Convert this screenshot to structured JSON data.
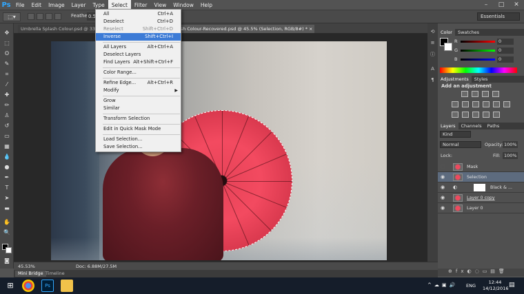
{
  "app": {
    "logo": "Ps"
  },
  "menubar": {
    "items": [
      "File",
      "Edit",
      "Image",
      "Layer",
      "Type",
      "Select",
      "Filter",
      "View",
      "Window",
      "Help"
    ],
    "active": "Select"
  },
  "window_controls": {
    "minimize": "–",
    "maximize": "□",
    "close": "✕"
  },
  "options": {
    "feather_label": "Feather:",
    "feather_value": "0.5",
    "workspace": "Essentials"
  },
  "tabs": {
    "doc1": "Umbrella Splash Colour.psd @ 33.3%",
    "doc2": "lsh Colour-Recovered.psd @ 45.5% (Selection, RGB/8#) * ×"
  },
  "status": {
    "zoom": "45.53%",
    "docsize": "Doc: 6.88M/27.5M"
  },
  "bottom_tabs": {
    "mini_bridge": "Mini Bridge",
    "timeline": "Timeline"
  },
  "select_menu": [
    {
      "label": "All",
      "shortcut": "Ctrl+A"
    },
    {
      "label": "Deselect",
      "shortcut": "Ctrl+D"
    },
    {
      "label": "Reselect",
      "shortcut": "Shift+Ctrl+D",
      "disabled": true
    },
    {
      "label": "Inverse",
      "shortcut": "Shift+Ctrl+I",
      "highlighted": true
    },
    {
      "label": "All Layers",
      "shortcut": "Alt+Ctrl+A"
    },
    {
      "label": "Deselect Layers",
      "shortcut": ""
    },
    {
      "label": "Find Layers",
      "shortcut": "Alt+Shift+Ctrl+F"
    },
    {
      "label": "Color Range...",
      "shortcut": ""
    },
    {
      "label": "Refine Edge...",
      "shortcut": "Alt+Ctrl+R"
    },
    {
      "label": "Modify",
      "shortcut": "",
      "submenu": true
    },
    {
      "label": "Grow",
      "shortcut": ""
    },
    {
      "label": "Similar",
      "shortcut": ""
    },
    {
      "label": "Transform Selection",
      "shortcut": ""
    },
    {
      "label": "Edit in Quick Mask Mode",
      "shortcut": ""
    },
    {
      "label": "Load Selection...",
      "shortcut": ""
    },
    {
      "label": "Save Selection...",
      "shortcut": ""
    }
  ],
  "color_panel": {
    "tab1": "Color",
    "tab2": "Swatches",
    "r_label": "R",
    "g_label": "G",
    "b_label": "B",
    "r": "0",
    "g": "0",
    "b": "0"
  },
  "adjustments_panel": {
    "tab1": "Adjustments",
    "tab2": "Styles",
    "title": "Add an adjustment"
  },
  "layers_panel": {
    "tab1": "Layers",
    "tab2": "Channels",
    "tab3": "Paths",
    "kind": "Kind",
    "blend": "Normal",
    "opacity_label": "Opacity:",
    "opacity": "100%",
    "lock_label": "Lock:",
    "fill_label": "Fill:",
    "fill": "100%",
    "layers": [
      {
        "name": "Mask",
        "visible": false
      },
      {
        "name": "Selection",
        "visible": true,
        "selected": true
      },
      {
        "name": "Black & ...",
        "visible": true,
        "adjustment": true
      },
      {
        "name": "Layer 0 copy",
        "visible": true
      },
      {
        "name": "Layer 0",
        "visible": true
      }
    ]
  },
  "taskbar": {
    "lang": "ENG",
    "time": "12:44",
    "date": "14/12/2016"
  }
}
